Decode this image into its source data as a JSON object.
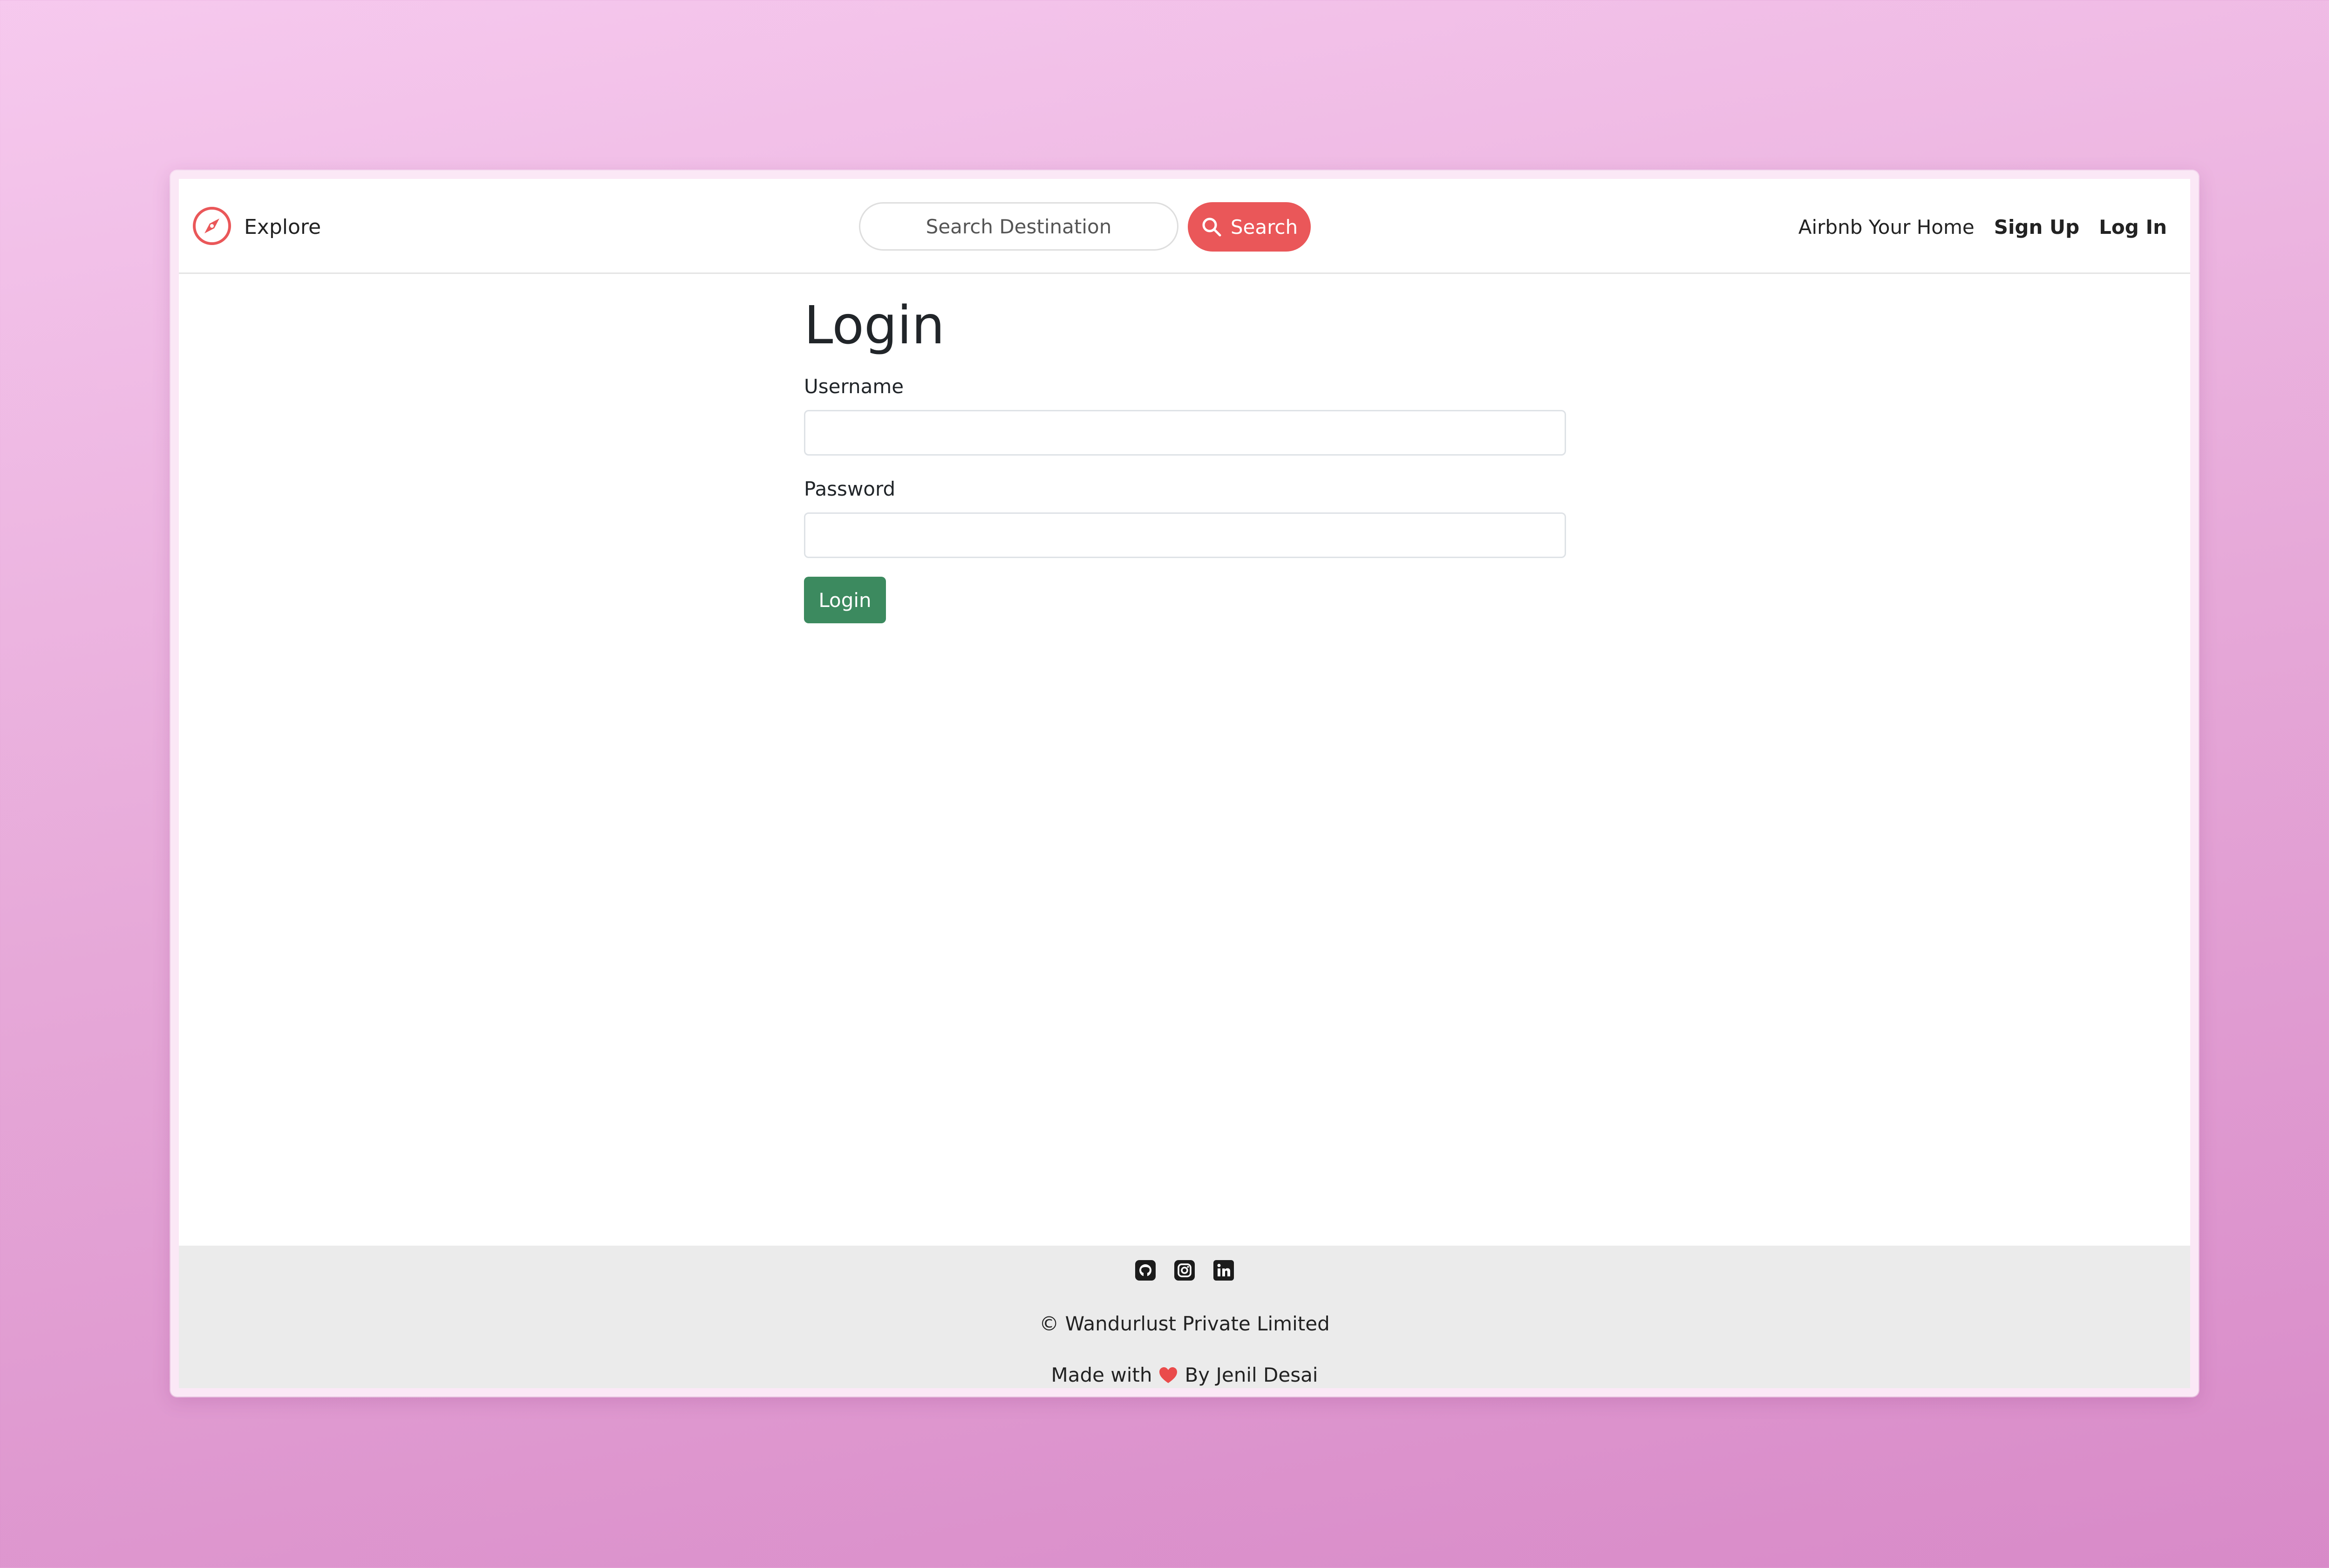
{
  "navbar": {
    "brand_icon": "compass-icon",
    "explore_label": "Explore",
    "search": {
      "placeholder": "Search Destination",
      "value": "",
      "button_label": "Search",
      "button_icon": "search-icon"
    },
    "links": {
      "airbnb_home": "Airbnb Your Home",
      "sign_up": "Sign Up",
      "log_in": "Log In"
    }
  },
  "login_form": {
    "title": "Login",
    "username_label": "Username",
    "username_value": "",
    "password_label": "Password",
    "password_value": "",
    "submit_label": "Login"
  },
  "footer": {
    "social_icons": [
      "github-icon",
      "instagram-icon",
      "linkedin-icon"
    ],
    "copyright": "© Wandurlust Private Limited",
    "made_with_prefix": "Made with",
    "made_with_icon": "heart-icon",
    "made_with_suffix": "By Jenil Desai"
  },
  "colors": {
    "brand_red": "#ea5759",
    "login_green": "#3c8a5f",
    "footer_bg": "#ebebeb",
    "background_gradient": [
      "#f6c9ee",
      "#d88ac8"
    ]
  }
}
